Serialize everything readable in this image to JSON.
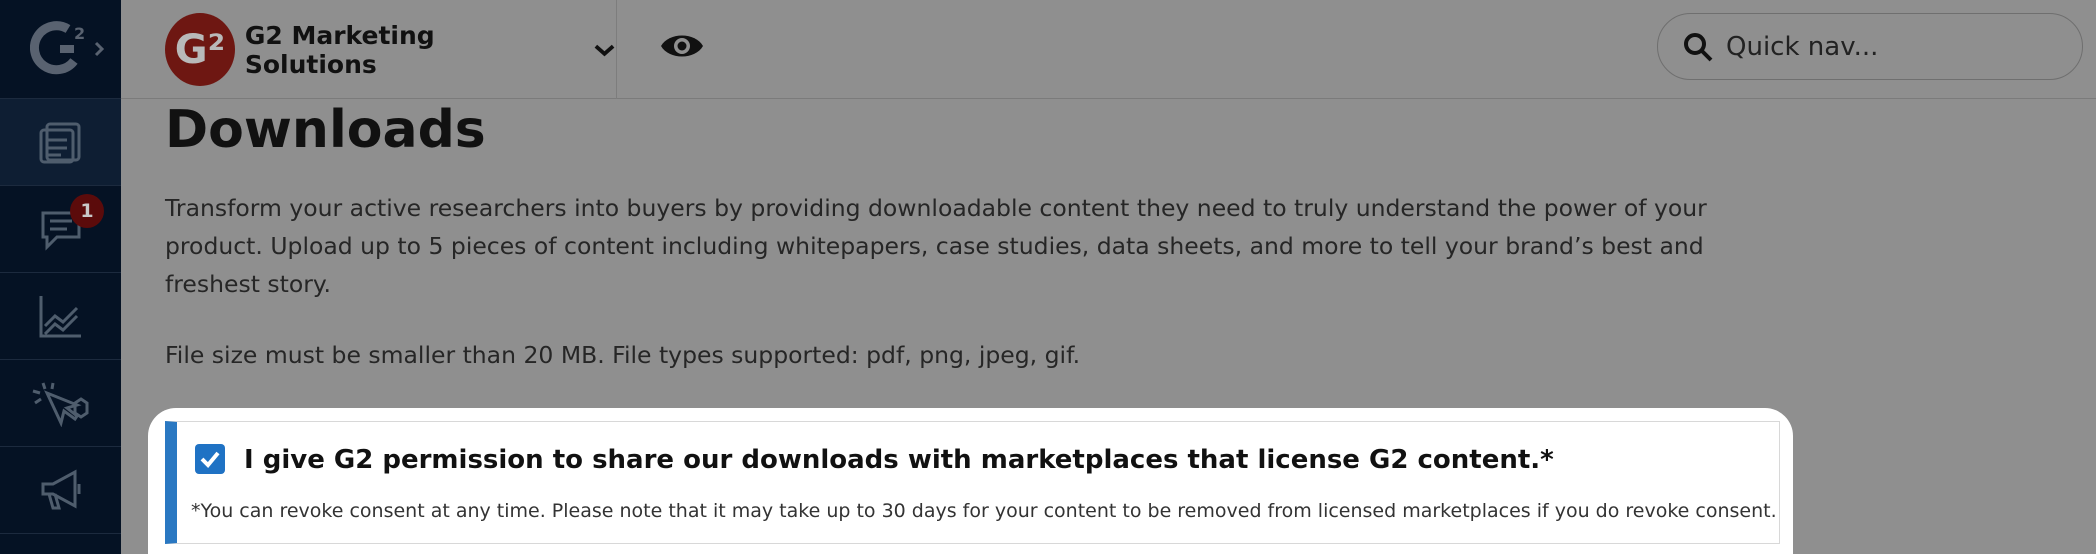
{
  "rail": {
    "notifications_badge": "1"
  },
  "topbar": {
    "org_logo_text": "G²",
    "org_name": "G2 Marketing Solutions",
    "search_placeholder": "Quick nav..."
  },
  "content": {
    "title": "Downloads",
    "description": "Transform your active researchers into buyers by providing downloadable content they need to truly understand the power of your product. Upload up to 5 pieces of content including whitepapers, case studies, data sheets, and more to tell your brand’s best and freshest story.",
    "file_note": "File size must be smaller than 20 MB. File types supported: pdf, png, jpeg, gif."
  },
  "consent": {
    "checked": true,
    "label": "I give G2 permission to share our downloads with marketplaces that license G2 content.*",
    "note": "*You can revoke consent at any time. Please note that it may take up to 30 days for your content to be removed from licensed marketplaces if you do revoke consent."
  },
  "colors": {
    "rail_bg": "#051224",
    "overlay_bg": "#8f8f8f",
    "accent_blue": "#2a78c2",
    "brand_red": "#d93a2c"
  }
}
